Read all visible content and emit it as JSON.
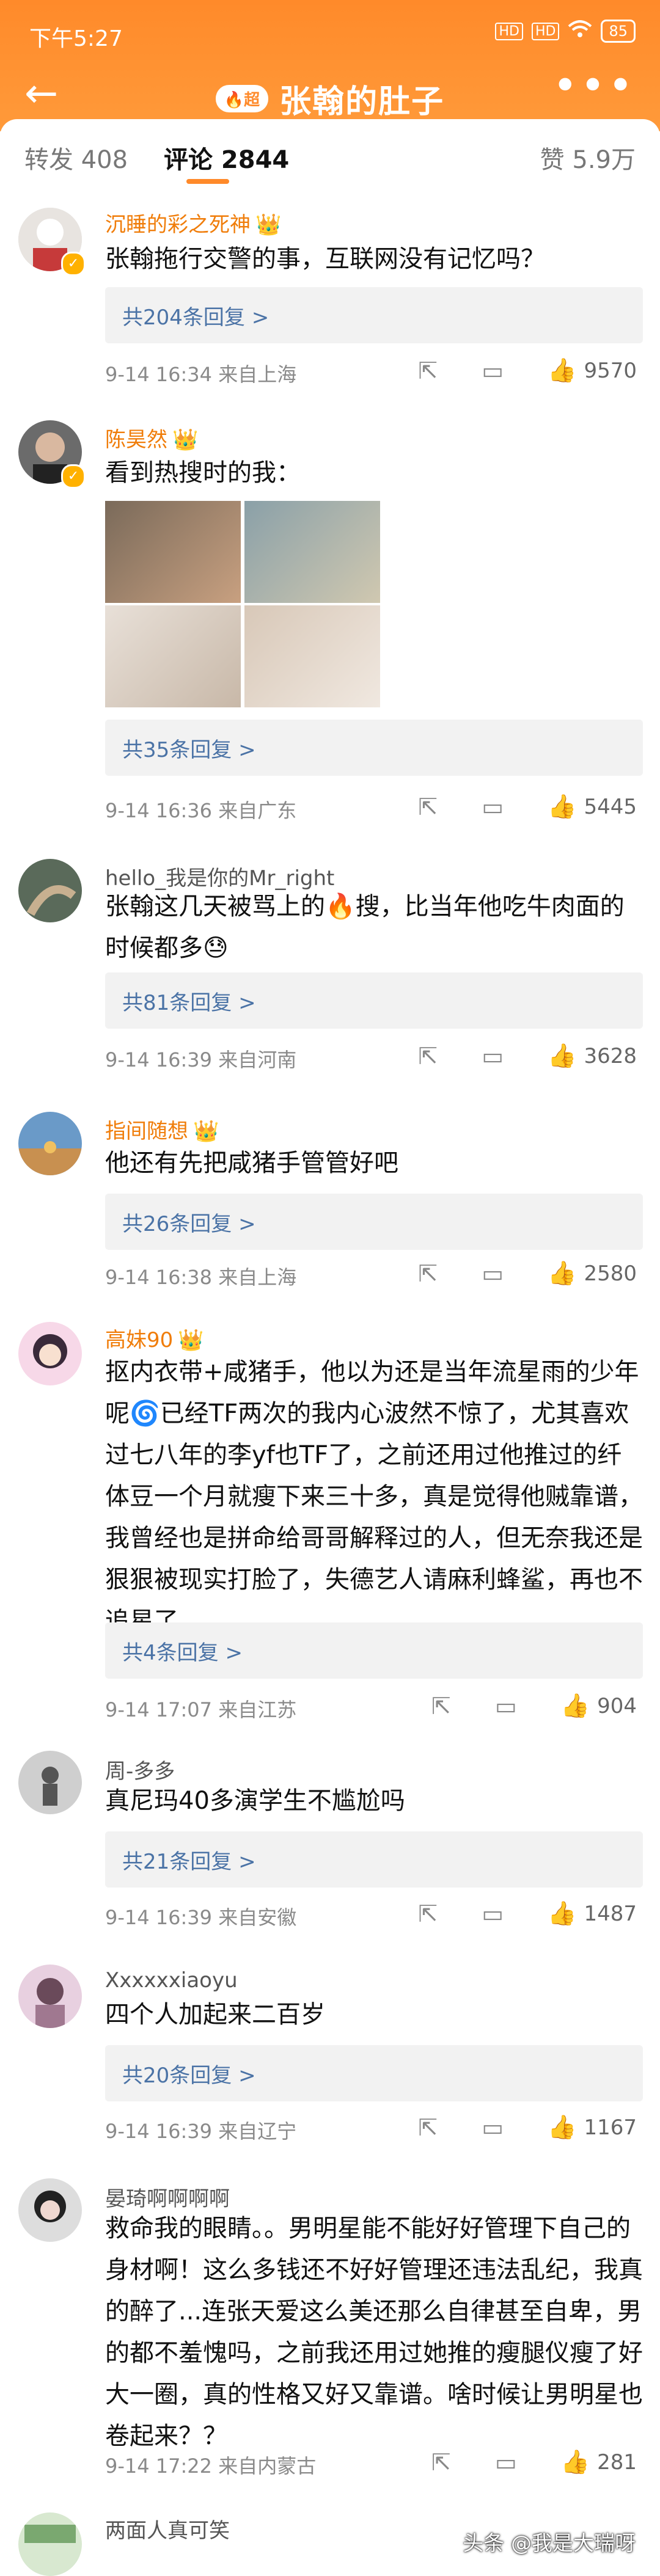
{
  "status_bar": {
    "time": "下午5:27",
    "network_1": "HD",
    "network_2": "HD",
    "battery": "85"
  },
  "nav": {
    "back_icon": "←",
    "badge": "🔥超",
    "title": "张翰的肚子",
    "more_icon": "•••"
  },
  "tabs": {
    "repost": "转发 408",
    "comment": "评论 2844",
    "like": "赞 5.9万"
  },
  "comments": [
    {
      "user": "沉睡的彩之死神",
      "crown": "👑",
      "text": "张翰拖行交警的事，互联网没有记忆吗？",
      "replies": "共204条回复 >",
      "time": "9-14 16:34",
      "loc": "来自上海",
      "likes": "9570"
    },
    {
      "user": "陈昊然",
      "crown": "👑",
      "text": "看到热搜时的我：",
      "replies": "共35条回复 >",
      "time": "9-14 16:36",
      "loc": "来自广东",
      "likes": "5445"
    },
    {
      "user": "hello_我是你的Mr_right",
      "text": "张翰这几天被骂上的🔥搜，比当年他吃牛肉面的时候都多😓",
      "replies": "共81条回复 >",
      "time": "9-14 16:39",
      "loc": "来自河南",
      "likes": "3628"
    },
    {
      "user": "指间随想",
      "crown": "👑",
      "text": "他还有先把咸猪手管管好吧",
      "replies": "共26条回复 >",
      "time": "9-14 16:38",
      "loc": "来自上海",
      "likes": "2580"
    },
    {
      "user": "高妹90",
      "crown": "👑",
      "text": "抠内衣带+咸猪手，他以为还是当年流星雨的少年呢🌀已经TF两次的我内心波然不惊了，尤其喜欢过七八年的李yf也TF了，之前还用过他推过的纤体豆一个月就瘦下来三十多，真是觉得他贼靠谱，我曾经也是拼命给哥哥解释过的人，但无奈我还是狠狠被现实打脸了，失德艺人请麻利蜂鲨，再也不追星了",
      "replies": "共4条回复 >",
      "time": "9-14 17:07",
      "loc": "来自江苏",
      "likes": "904"
    },
    {
      "user": "周-多多",
      "text": "真尼玛40多演学生不尴尬吗",
      "replies": "共21条回复 >",
      "time": "9-14 16:39",
      "loc": "来自安徽",
      "likes": "1487"
    },
    {
      "user": "Xxxxxxiaoyu",
      "text": "四个人加起来二百岁",
      "replies": "共20条回复 >",
      "time": "9-14 16:39",
      "loc": "来自辽宁",
      "likes": "1167"
    },
    {
      "user": "晏琦啊啊啊啊",
      "text": "救命我的眼睛。。男明星能不能好好管理下自己的身材啊！这么多钱还不好好管理还违法乱纪，我真的醉了...连张天爱这么美还那么自律甚至自卑，男的都不羞愧吗，之前我还用过她推的瘦腿仪瘦了好大一圈，真的性格又好又靠谱。啥时候让男明星也卷起来？？",
      "time": "9-14 17:22",
      "loc": "来自内蒙古",
      "likes": "281"
    },
    {
      "user": "两面人真可笑"
    }
  ],
  "icons": {
    "share": "share-icon",
    "comment": "comment-icon",
    "like": "thumb-up-icon"
  },
  "watermark": "头条 @我是大瑞呀",
  "colors": {
    "accent": "#ff8a2a",
    "username": "#f07d0a",
    "reply_link": "#4b73a6"
  }
}
